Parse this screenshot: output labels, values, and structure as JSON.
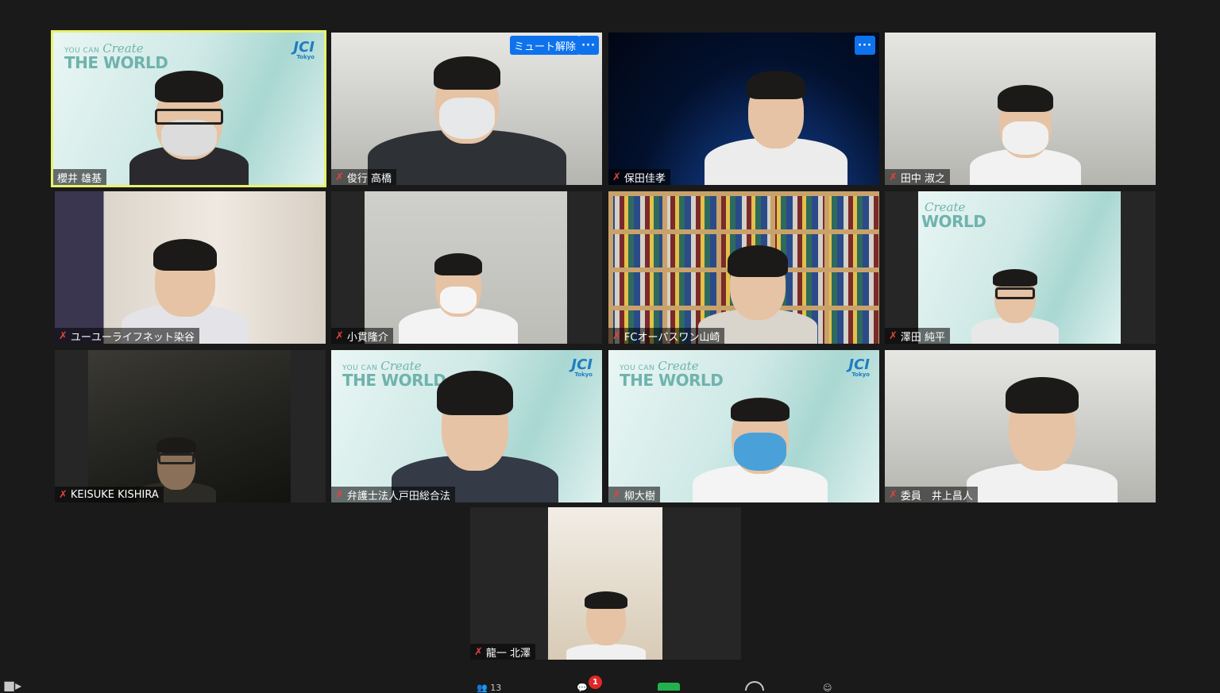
{
  "participants": [
    {
      "id": "p1",
      "name": "櫻井 雄基",
      "muted": false,
      "active": true
    },
    {
      "id": "p2",
      "name": "俊行 高橋",
      "muted": true,
      "unmute_label": "ミュート解除",
      "more_label": "···"
    },
    {
      "id": "p3",
      "name": "保田佳孝",
      "muted": true,
      "more_label": "···"
    },
    {
      "id": "p4",
      "name": "田中 淑之",
      "muted": true
    },
    {
      "id": "p5",
      "name": "ユーユーライフネット染谷",
      "muted": true
    },
    {
      "id": "p6",
      "name": "小貫隆介",
      "muted": true
    },
    {
      "id": "p7",
      "name": "FCオーパスワン山崎",
      "muted": true
    },
    {
      "id": "p8",
      "name": "澤田 純平",
      "muted": true
    },
    {
      "id": "p9",
      "name": "KEISUKE KISHIRA",
      "muted": true
    },
    {
      "id": "p10",
      "name": "弁護士法人戸田総合法",
      "muted": true
    },
    {
      "id": "p11",
      "name": "柳大樹",
      "muted": true
    },
    {
      "id": "p12",
      "name": "委員　井上昌人",
      "muted": true
    },
    {
      "id": "p13",
      "name": "龍一 北澤",
      "muted": true
    }
  ],
  "branding": {
    "you_can": "YOU CAN",
    "create": "Create",
    "the_world": "THE WORLD",
    "world": "WORLD",
    "jci": "JCI",
    "tokyo": "Tokyo"
  },
  "toolbar": {
    "participants_count": "13",
    "chat_badge": "1"
  },
  "colors": {
    "background": "#1a1a1a",
    "active_speaker": "#e8f26b",
    "accent": "#0e72ed",
    "muted_icon": "#e0443c"
  }
}
